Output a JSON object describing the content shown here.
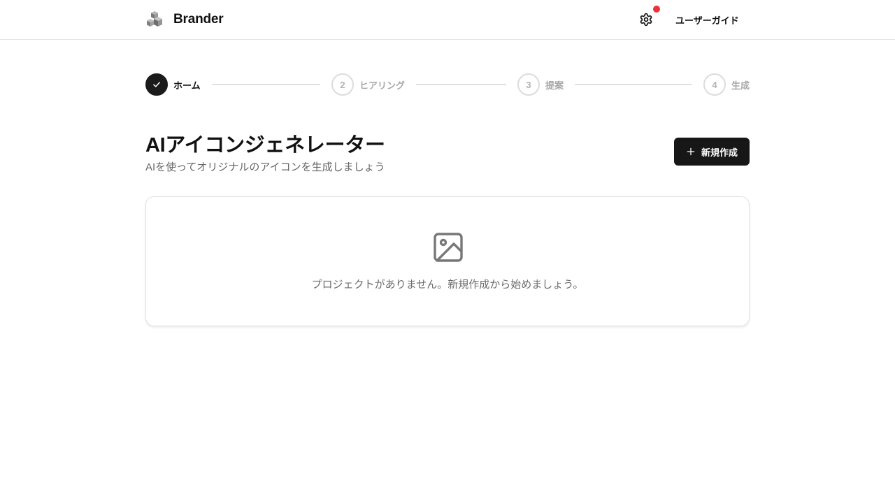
{
  "header": {
    "brand_name": "Brander",
    "logo_icon": "cubes-logo-icon",
    "settings_icon": "gear-icon",
    "notification_color": "#ef2f3c",
    "guide_label": "ユーザーガイド"
  },
  "stepper": {
    "steps": [
      {
        "number": "1",
        "label": "ホーム",
        "status": "completed"
      },
      {
        "number": "2",
        "label": "ヒアリング",
        "status": "upcoming"
      },
      {
        "number": "3",
        "label": "提案",
        "status": "upcoming"
      },
      {
        "number": "4",
        "label": "生成",
        "status": "upcoming"
      }
    ]
  },
  "main": {
    "title": "AIアイコンジェネレーター",
    "subtitle": "AIを使ってオリジナルのアイコンを生成しましょう",
    "new_button_label": "新規作成",
    "new_button_icon": "plus-icon"
  },
  "empty_state": {
    "icon": "image-icon",
    "message": "プロジェクトがありません。新規作成から始めましょう。"
  },
  "colors": {
    "primary": "#171717",
    "muted_text": "#6b6b6b",
    "border": "#e2e2e2"
  }
}
